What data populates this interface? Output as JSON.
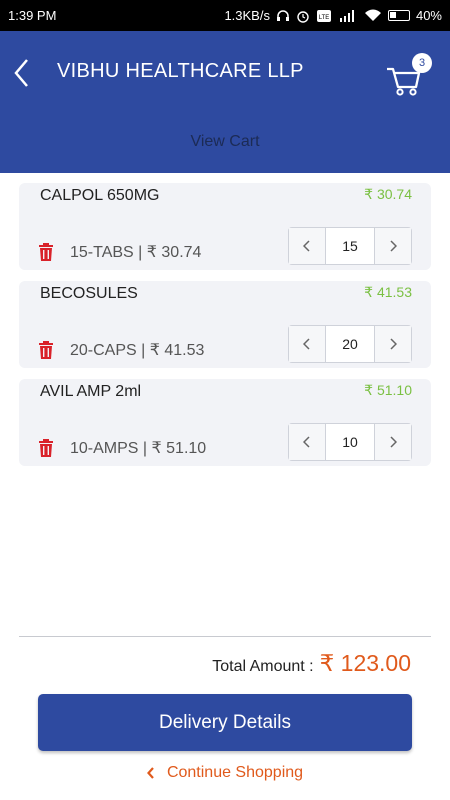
{
  "status_bar": {
    "time": "1:39 PM",
    "network_speed": "1.3KB/s",
    "battery": "40%"
  },
  "header": {
    "title": "VIBHU HEALTHCARE LLP",
    "cart_count": "3",
    "subtitle": "View Cart",
    "background": "#2e4aa0"
  },
  "cart_items": [
    {
      "name": "CALPOL 650MG",
      "price": "₹ 30.74",
      "desc": "15-TABS | ₹ 30.74",
      "quantity": "15"
    },
    {
      "name": "BECOSULES",
      "price": "₹ 41.53",
      "desc": "20-CAPS | ₹ 41.53",
      "quantity": "20"
    },
    {
      "name": "AVIL AMP 2ml",
      "price": "₹ 51.10",
      "desc": "10-AMPS | ₹ 51.10",
      "quantity": "10"
    }
  ],
  "summary": {
    "total_label": "Total Amount :",
    "total_value": "₹ 123.00"
  },
  "actions": {
    "delivery_label": "Delivery Details",
    "continue_label": "Continue Shopping"
  },
  "colors": {
    "accent": "#2e4aa0",
    "price_green": "#7bc043",
    "total_orange": "#e05a1c",
    "delete_red": "#d9222a"
  },
  "icons": [
    "back-arrow-icon",
    "cart-icon",
    "trash-icon",
    "chevron-left-icon",
    "chevron-right-icon"
  ]
}
